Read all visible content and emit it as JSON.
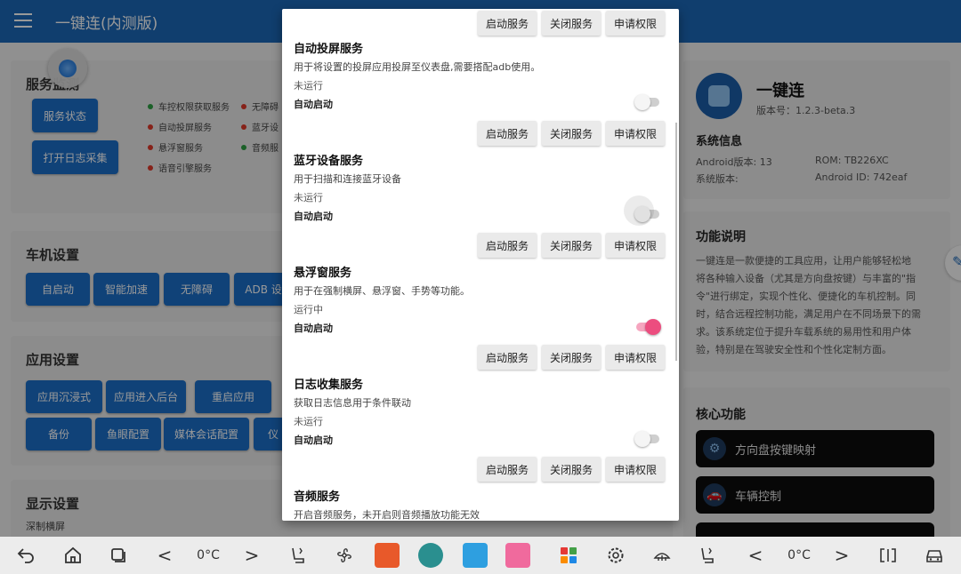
{
  "app": {
    "title": "一键连(内测版)",
    "name": "一键连",
    "version": "版本号：1.2.3-beta.3"
  },
  "service_monitor": {
    "title": "服务监测",
    "buttons": [
      "服务状态",
      "打开日志采集"
    ],
    "statuses": [
      {
        "label": "车控权限获取服务",
        "color": "#2ea043"
      },
      {
        "label": "无障碍",
        "color": "#e0392b"
      },
      {
        "label": "自动投屏服务",
        "color": "#e0392b"
      },
      {
        "label": "蓝牙设",
        "color": "#e0392b"
      },
      {
        "label": "悬浮窗服务",
        "color": "#2ea043"
      },
      {
        "label": "音频服",
        "color": "#2ea043"
      },
      {
        "label": "语音引擎服务",
        "color": "#e0392b"
      }
    ]
  },
  "car_settings": {
    "title": "车机设置",
    "buttons": [
      "自启动",
      "智能加速",
      "无障碍",
      "ADB 设"
    ]
  },
  "app_settings": {
    "title": "应用设置",
    "buttons_row1": [
      "应用沉浸式",
      "应用进入后台",
      "重启应用"
    ],
    "buttons_row2": [
      "备份",
      "鱼眼配置",
      "媒体会话配置",
      "仪"
    ]
  },
  "display_settings": {
    "title": "显示设置",
    "subtitle": "深制横屏"
  },
  "system_info": {
    "title": "系统信息",
    "android_version": "Android版本: 13",
    "rom": "ROM: TB226XC",
    "system_version": "系统版本:",
    "android_id": "Android ID: 742eaf"
  },
  "feature_desc": {
    "title": "功能说明",
    "lines": [
      "一键连是一款便捷的工具应用，让用户能够轻松地",
      "将各种输入设备（尤其是方向盘按键）与丰富的\"指",
      "令\"进行绑定，实现个性化、便捷化的车机控制。同",
      "时，结合远程控制功能，满足用户在不同场景下的需",
      "求。该系统定位于提升车载系统的易用性和用户体",
      "验，特别是在驾驶安全性和个性化定制方面。"
    ]
  },
  "core_features": {
    "title": "核心功能",
    "items": [
      {
        "label": "方向盘按键映射",
        "icon": "gear-icon"
      },
      {
        "label": "车辆控制",
        "icon": "car-icon"
      }
    ]
  },
  "dialog": {
    "actions": [
      "启动服务",
      "关闭服务",
      "申请权限"
    ],
    "auto_start_label": "自动启动",
    "services": [
      {
        "name": "自动投屏服务",
        "desc": "用于将设置的投屏应用投屏至仪表盘,需要搭配adb使用。",
        "status": "未运行",
        "auto_start": false
      },
      {
        "name": "蓝牙设备服务",
        "desc": "用于扫描和连接蓝牙设备",
        "status": "未运行",
        "auto_start": false
      },
      {
        "name": "悬浮窗服务",
        "desc": "用于在强制横屏、悬浮窗、手势等功能。",
        "status": "运行中",
        "auto_start": true
      },
      {
        "name": "日志收集服务",
        "desc": "获取日志信息用于条件联动",
        "status": "未运行",
        "auto_start": false
      },
      {
        "name": "音频服务",
        "desc": "开启音频服务，未开启则音频播放功能无效"
      }
    ]
  },
  "navbar": {
    "temp_left": "0°C",
    "temp_right": "0°C",
    "left_chevron": "<",
    "right_chevron": ">",
    "colors": {
      "accent": "#1c68b8",
      "toggle_on": "#ec4d7f"
    }
  }
}
